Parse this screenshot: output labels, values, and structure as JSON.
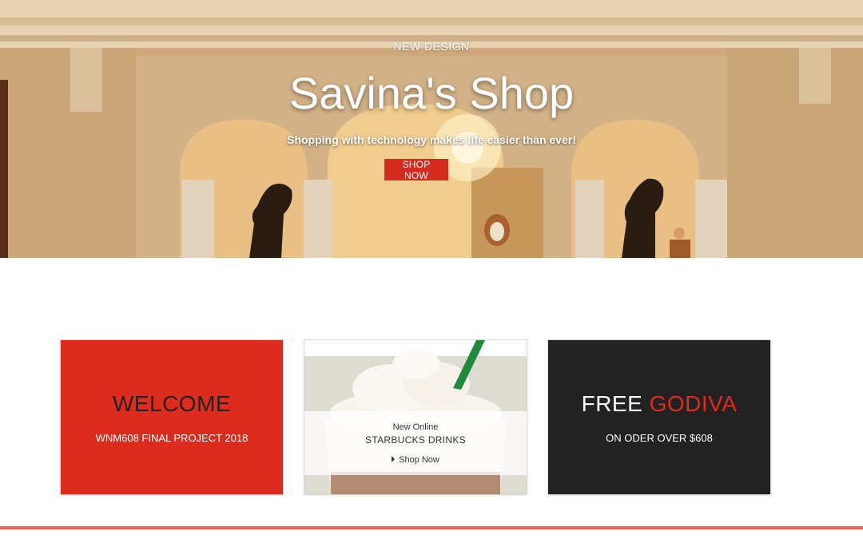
{
  "hero": {
    "eyebrow": "NEW DESIGN",
    "title": "Savina's Shop",
    "subtitle": "Shopping with technology makes life easier than ever!",
    "button_label": "SHOP NOW"
  },
  "cards": {
    "welcome": {
      "heading": "WELCOME",
      "text": "WNM608 FINAL PROJECT 2018"
    },
    "drink": {
      "kicker": "New Online",
      "title": "STARBUCKS DRINKS",
      "link_label": "Shop Now"
    },
    "godiva": {
      "heading_part1": "FREE",
      "heading_part2": "GODIVA",
      "text": "ON ODER OVER $608"
    }
  },
  "colors": {
    "accent": "#dd2c1e",
    "dark": "#222222",
    "rule": "#e86256"
  }
}
